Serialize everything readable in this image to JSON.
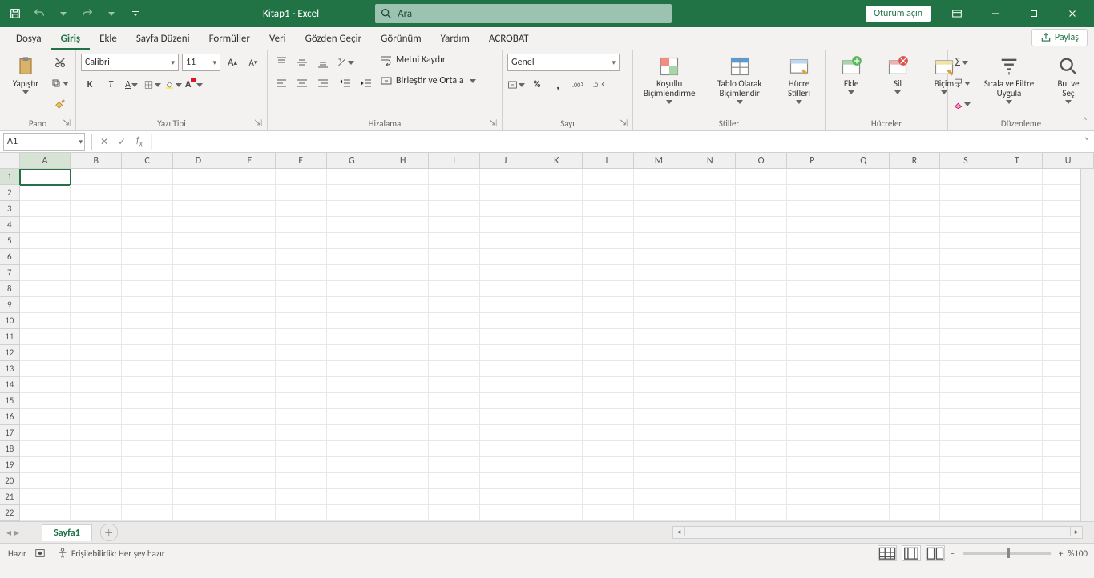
{
  "titlebar": {
    "doc_title": "Kitap1  -  Excel",
    "search_placeholder": "Ara",
    "signin": "Oturum açın"
  },
  "tabs": {
    "items": [
      "Dosya",
      "Giriş",
      "Ekle",
      "Sayfa Düzeni",
      "Formüller",
      "Veri",
      "Gözden Geçir",
      "Görünüm",
      "Yardım",
      "ACROBAT"
    ],
    "active_index": 1,
    "share": "Paylaş"
  },
  "ribbon": {
    "clipboard": {
      "paste": "Yapıştır",
      "label": "Pano"
    },
    "font": {
      "name": "Calibri",
      "size": "11",
      "label": "Yazı Tipi"
    },
    "alignment": {
      "wrap": "Metni Kaydır",
      "merge": "Birleştir ve Ortala",
      "label": "Hizalama"
    },
    "number": {
      "format": "Genel",
      "label": "Sayı"
    },
    "styles": {
      "cond": "Koşullu Biçimlendirme",
      "astable": "Tablo Olarak Biçimlendir",
      "cellstyles": "Hücre Stilleri",
      "label": "Stiller"
    },
    "cells": {
      "insert": "Ekle",
      "delete": "Sil",
      "format": "Biçim",
      "label": "Hücreler"
    },
    "editing": {
      "sort": "Sırala ve Filtre Uygula",
      "find": "Bul ve Seç",
      "label": "Düzenleme"
    }
  },
  "formula_bar": {
    "namebox": "A1"
  },
  "grid": {
    "columns": [
      "A",
      "B",
      "C",
      "D",
      "E",
      "F",
      "G",
      "H",
      "I",
      "J",
      "K",
      "L",
      "M",
      "N",
      "O",
      "P",
      "Q",
      "R",
      "S",
      "T",
      "U"
    ],
    "rows": 22,
    "selected": {
      "row": 1,
      "col": "A"
    }
  },
  "sheets": {
    "active": "Sayfa1"
  },
  "status": {
    "ready": "Hazır",
    "accessibility": "Erişilebilirlik: Her şey hazır",
    "zoom": "%100"
  }
}
